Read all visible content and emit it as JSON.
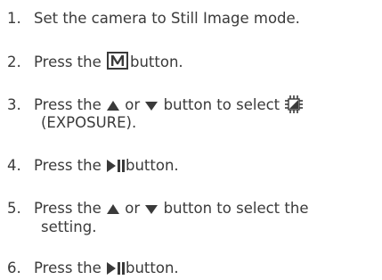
{
  "steps": [
    {
      "num": "1.",
      "text": "Set the camera to Still Image mode."
    },
    {
      "num": "2.",
      "before": "Press the",
      "after": "button.",
      "icon": "menu-m-icon"
    },
    {
      "num": "3.",
      "before": "Press the",
      "mid1": "or",
      "mid2": "button to select",
      "line2": "(EXPOSURE).",
      "icons": [
        "up-triangle-icon",
        "down-triangle-icon",
        "exposure-icon"
      ]
    },
    {
      "num": "4.",
      "before": "Press the",
      "after": "button.",
      "icon": "play-pause-icon"
    },
    {
      "num": "5.",
      "before": "Press the",
      "mid1": "or",
      "after": "button to select the",
      "line2": "setting.",
      "icons": [
        "up-triangle-icon",
        "down-triangle-icon"
      ]
    },
    {
      "num": "6.",
      "before": "Press the",
      "after": "button.",
      "icon": "play-pause-icon"
    }
  ],
  "colors": {
    "text": "#3a3a3a"
  }
}
